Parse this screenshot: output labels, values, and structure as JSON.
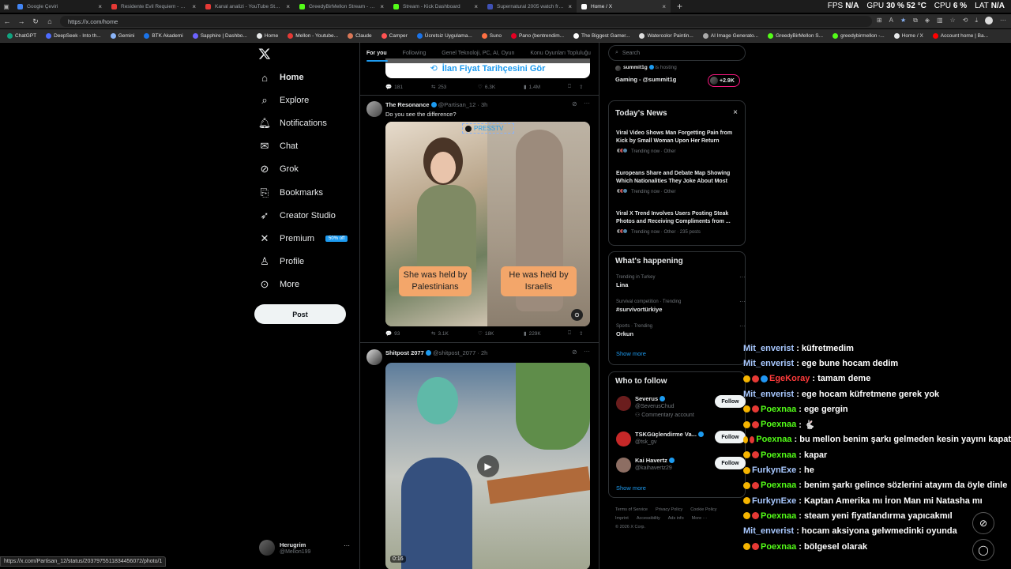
{
  "browser": {
    "tabs": [
      {
        "label": "Google Çeviri",
        "color": "#4285f4",
        "active": false
      },
      {
        "label": "Residente Evil Requiem - Bölüm 5",
        "color": "#e53935",
        "active": false
      },
      {
        "label": "Kanal analizi - YouTube Studio",
        "color": "#e53935",
        "active": false
      },
      {
        "label": "GreedyBirMellon Stream - Watch",
        "color": "#53fc18",
        "active": false
      },
      {
        "label": "Stream - Kick Dashboard",
        "color": "#53fc18",
        "active": false
      },
      {
        "label": "Supernatural 2005 watch free - 1x",
        "color": "#3f51b5",
        "active": false
      },
      {
        "label": "Home / X",
        "color": "#ffffff",
        "active": true
      }
    ],
    "new_tab": "+",
    "url": "https://x.com/home",
    "stats": {
      "fps_label": "FPS",
      "fps": "N/A",
      "gpu_label": "GPU",
      "gpu": "30 % 52 °C",
      "cpu_label": "CPU",
      "cpu": "6 %",
      "lat_label": "LAT",
      "lat": "N/A"
    },
    "bookmarks": [
      "ChatGPT",
      "DeepSeek - Into th...",
      "Gemini",
      "BTK Akademi",
      "Sapphire | Dashbo...",
      "Home",
      "Mellon - Youtube...",
      "Claude",
      "Camper",
      "Ücretsiz Uygulama...",
      "Suno",
      "Pano (bentrendim...",
      "The Biggest Gamer...",
      "Watercolor Paintin...",
      "AI Image Generato...",
      "GreedyBirMellon S...",
      "greedybirmellon -...",
      "Home / X",
      "Account home | Ba..."
    ],
    "status_url": "https://x.com/Partisan_12/status/2037975511834456072/photo/1"
  },
  "nav": {
    "items": [
      {
        "label": "Home",
        "icon": "home-icon"
      },
      {
        "label": "Explore",
        "icon": "search-icon"
      },
      {
        "label": "Notifications",
        "icon": "bell-icon"
      },
      {
        "label": "Chat",
        "icon": "mail-icon"
      },
      {
        "label": "Grok",
        "icon": "grok-icon"
      },
      {
        "label": "Bookmarks",
        "icon": "bookmark-icon"
      },
      {
        "label": "Creator Studio",
        "icon": "rocket-icon"
      },
      {
        "label": "Premium",
        "icon": "x-icon"
      },
      {
        "label": "Profile",
        "icon": "person-icon"
      },
      {
        "label": "More",
        "icon": "more-circle-icon"
      }
    ],
    "premium_badge": "50% off",
    "post_button": "Post",
    "account": {
      "name": "Herugrim",
      "handle": "@Mellon199",
      "more": "···"
    }
  },
  "timeline": {
    "tabs": [
      "For you",
      "Following",
      "Genel Teknoloji, PC, AI, Oyun",
      "Konu Oyunları Topluluğu"
    ],
    "prev_tweet": {
      "banner_text": "İlan Fiyat Tarihçesini Gör",
      "stats": {
        "replies": "181",
        "reposts": "253",
        "likes": "6.3K",
        "views": "1.4M"
      }
    },
    "tweet1": {
      "name": "The Resonance",
      "handle": "@Partisan_12",
      "time": "3h",
      "text": "Do you see the difference?",
      "media_label": "PRESSTV",
      "caption_left": "She was held by Palestinians",
      "caption_right": "He was held by Israelis",
      "stats": {
        "replies": "93",
        "reposts": "3.1K",
        "likes": "18K",
        "views": "229K"
      }
    },
    "tweet2": {
      "name": "Shitpost 2077",
      "handle": "@shitpost_2077",
      "time": "2h",
      "duration": "0:16"
    }
  },
  "right": {
    "search_placeholder": "Search",
    "live": {
      "host": "summit1g",
      "hosting_text": "is hosting",
      "title": "Gaming - @summit1g",
      "count": "+2.9K"
    },
    "news": {
      "title": "Today's News",
      "close": "×",
      "items": [
        {
          "title": "Viral Video Shows Man Forgetting Pain from Kick by Small Woman Upon Her Return",
          "meta": "Trending now · Other"
        },
        {
          "title": "Europeans Share and Debate Map Showing Which Nationalities They Joke About Most",
          "meta": "Trending now · Other"
        },
        {
          "title": "Viral X Trend Involves Users Posting Steak Photos and Receiving Compliments from ...",
          "meta": "Trending now · Other · 235 posts"
        }
      ]
    },
    "happening": {
      "title": "What's happening",
      "items": [
        {
          "context": "Trending in Turkey",
          "name": "Lina"
        },
        {
          "context": "Survival competition · Trending",
          "name": "#survivortürkiye"
        },
        {
          "context": "Sports · Trending",
          "name": "Orkun"
        }
      ],
      "show_more": "Show more"
    },
    "follow": {
      "title": "Who to follow",
      "items": [
        {
          "name": "Severus",
          "handle": "@SeverusChud",
          "sub": "Commentary account",
          "button": "Follow"
        },
        {
          "name": "TSKGüçlendirme Va...",
          "handle": "@tsk_gv",
          "sub": "",
          "button": "Follow"
        },
        {
          "name": "Kai Havertz",
          "handle": "@kaihavertz29",
          "sub": "",
          "button": "Follow"
        }
      ],
      "show_more": "Show more"
    },
    "footer": [
      "Terms of Service",
      "Privacy Policy",
      "Cookie Policy",
      "Imprint",
      "Accessibility",
      "Ads info",
      "More ···",
      "© 2026 X Corp."
    ]
  },
  "chat": [
    {
      "user": "Mit_enverist",
      "text": ": küfretmedim",
      "color": "#a8c8ff",
      "badges": 0
    },
    {
      "user": "Mit_enverist",
      "text": ": ege bune hocam dedim",
      "color": "#a8c8ff",
      "badges": 0
    },
    {
      "user": "EgeKoray",
      "text": ": tamam deme",
      "color": "#ff3b3b",
      "badges": 3
    },
    {
      "user": "Mit_enverist",
      "text": ": ege hocam küfretmene gerek yok",
      "color": "#a8c8ff",
      "badges": 0
    },
    {
      "user": "Poexnaa",
      "text": ": ege gergin",
      "color": "#53fc18",
      "badges": 2
    },
    {
      "user": "Poexnaa",
      "text": ": 🐇",
      "color": "#53fc18",
      "badges": 2
    },
    {
      "user": "Poexnaa",
      "text": ": bu mellon benim şarkı gelmeden kesin yayını kapat",
      "color": "#53fc18",
      "badges": 2
    },
    {
      "user": "Poexnaa",
      "text": ": kapar",
      "color": "#53fc18",
      "badges": 2
    },
    {
      "user": "FurkynExe",
      "text": ": he",
      "color": "#a8c8ff",
      "badges": 1
    },
    {
      "user": "Poexnaa",
      "text": ": benim şarkı gelince sözlerini atayım da öyle dinle",
      "color": "#53fc18",
      "badges": 2
    },
    {
      "user": "FurkynExe",
      "text": ": Kaptan Amerika mı İron Man mi Natasha mı",
      "color": "#a8c8ff",
      "badges": 1
    },
    {
      "user": "Poexnaa",
      "text": ": steam yeni fiyatlandırma yapıcakmıl",
      "color": "#53fc18",
      "badges": 2
    },
    {
      "user": "Mit_enverist",
      "text": ": hocam aksiyona gelwmedinki oyunda",
      "color": "#a8c8ff",
      "badges": 0
    },
    {
      "user": "Poexnaa",
      "text": ": bölgesel olarak",
      "color": "#53fc18",
      "badges": 2
    }
  ]
}
